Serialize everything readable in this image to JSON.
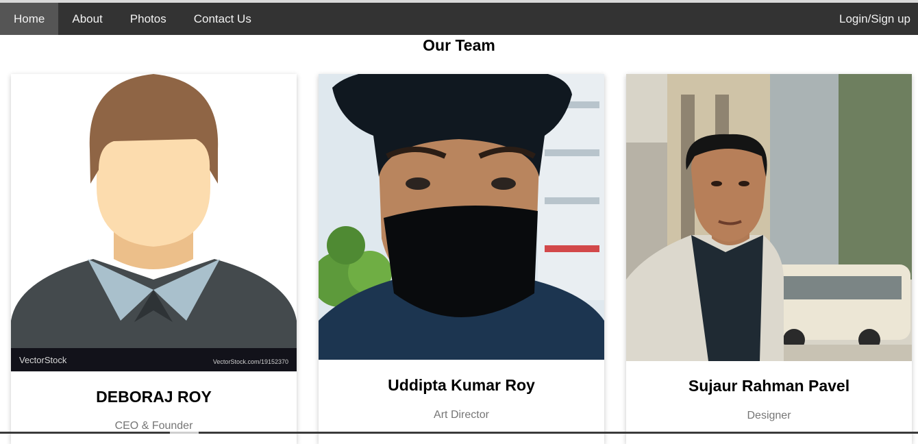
{
  "nav": {
    "items": [
      {
        "label": "Home"
      },
      {
        "label": "About"
      },
      {
        "label": "Photos"
      },
      {
        "label": "Contact Us"
      }
    ],
    "login_label": "Login/Sign up"
  },
  "page": {
    "title": "Our Team"
  },
  "team": [
    {
      "name": "DEBORAJ ROY",
      "role": "CEO & Founder",
      "watermark_left": "VectorStock",
      "watermark_right": "VectorStock.com/19152370"
    },
    {
      "name": "Uddipta Kumar Roy",
      "role": "Art Director"
    },
    {
      "name": "Sujaur Rahman Pavel",
      "role": "Designer"
    }
  ],
  "colors": {
    "navbar": "#333333",
    "active_tab": "#555555",
    "role_text": "#757575"
  }
}
